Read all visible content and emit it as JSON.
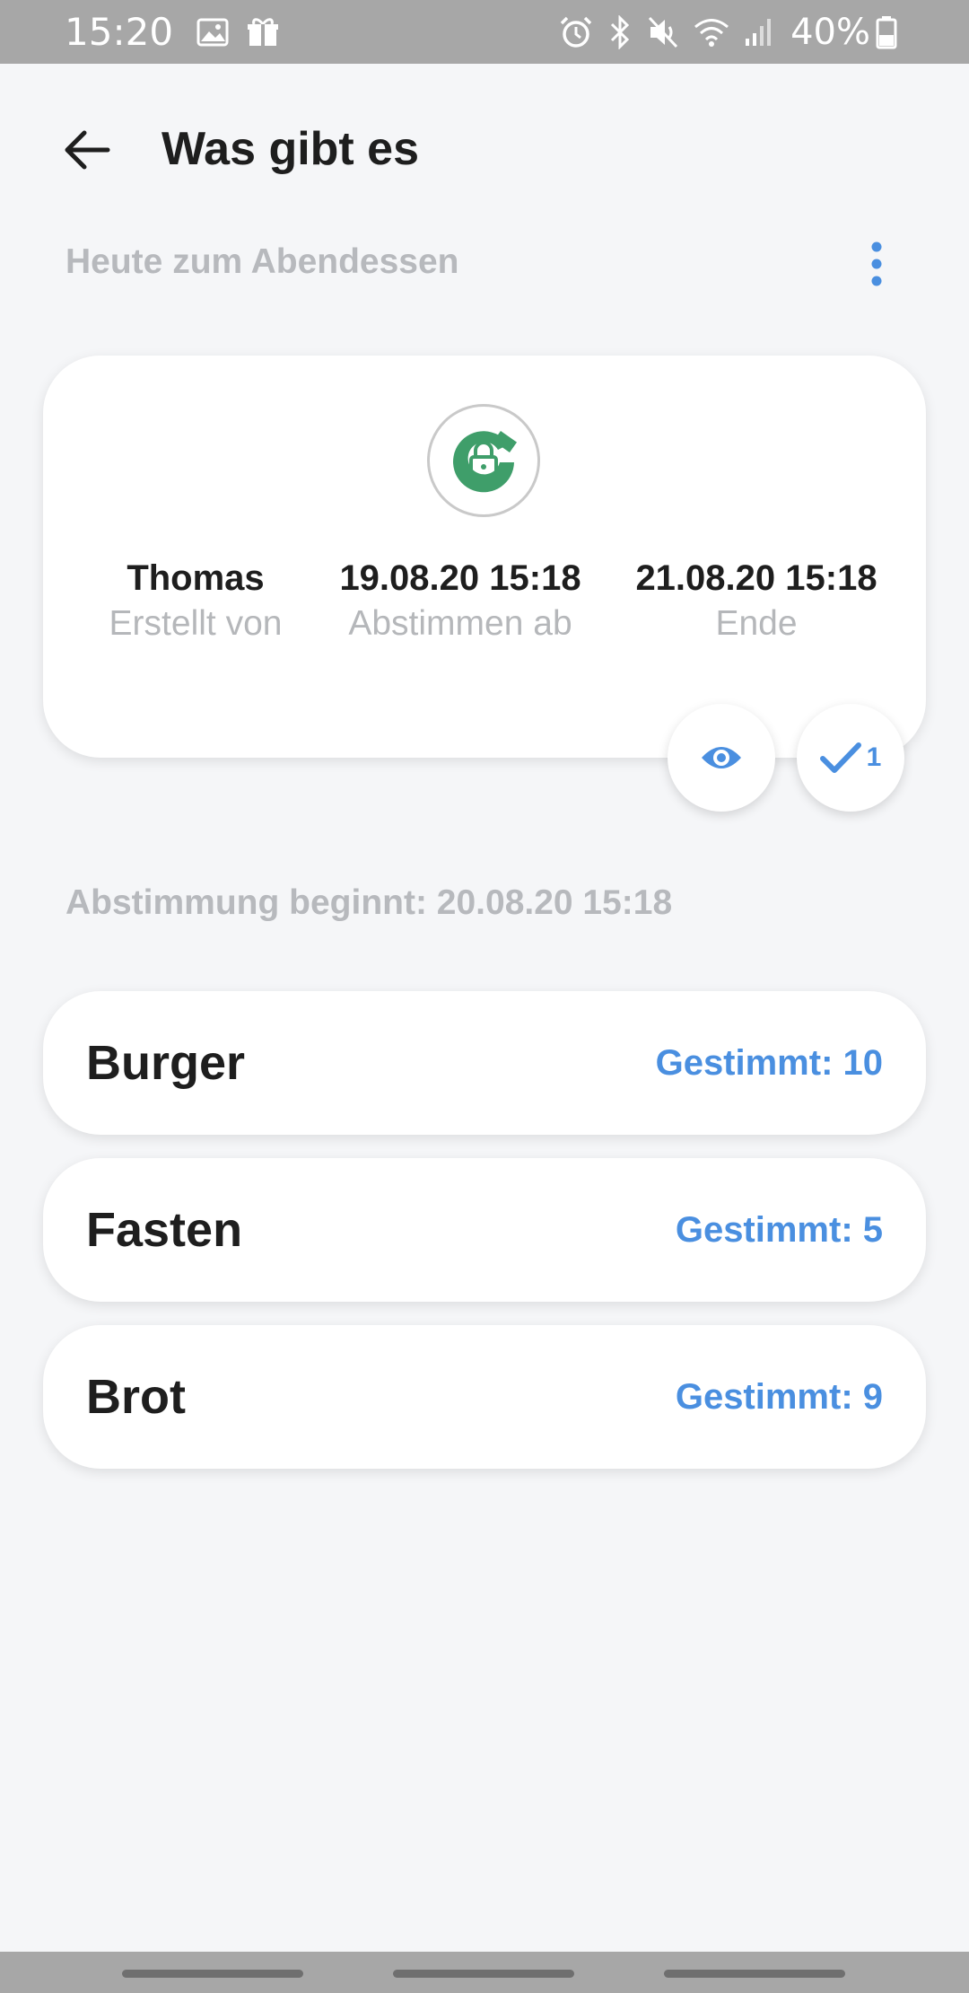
{
  "status_bar": {
    "time": "15:20",
    "battery": "40%",
    "left_icons": [
      "image-icon",
      "gift-icon"
    ],
    "right_icons": [
      "alarm-icon",
      "bluetooth-icon",
      "mute-icon",
      "wifi-icon",
      "signal-icon",
      "battery-icon"
    ]
  },
  "header": {
    "title": "Was gibt es",
    "back_icon": "back-arrow-icon"
  },
  "subtitle": "Heute zum Abendessen",
  "more_icon": "more-vertical-icon",
  "info_card": {
    "badge_icon": "lock-icon",
    "badge_color": "#3f9e6a",
    "creator": {
      "value": "Thomas",
      "label": "Erstellt von"
    },
    "start": {
      "value": "19.08.20 15:18",
      "label": "Abstimmen ab"
    },
    "end": {
      "value": "21.08.20 15:18",
      "label": "Ende"
    },
    "votes_count": "1"
  },
  "vote_start_text": "Abstimmung beginnt: 20.08.20 15:18",
  "options": [
    {
      "name": "Burger",
      "votes": "Gestimmt: 10"
    },
    {
      "name": "Fasten",
      "votes": "Gestimmt: 5"
    },
    {
      "name": "Brot",
      "votes": "Gestimmt: 9"
    }
  ],
  "colors": {
    "accent": "#4a8fe0",
    "background": "#f5f6f8",
    "muted_text": "#b7b9bd",
    "status_bar": "#a7a7a7"
  }
}
